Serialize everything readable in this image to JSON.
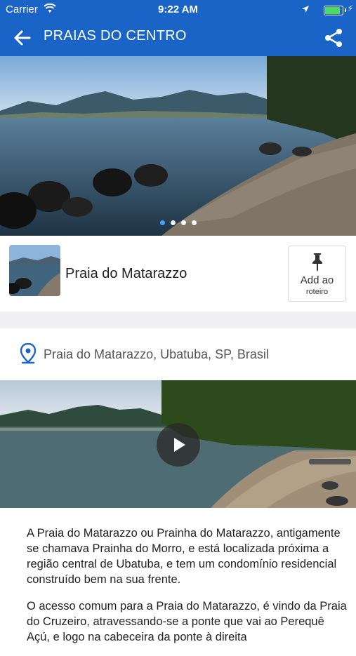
{
  "status_bar": {
    "carrier": "Carrier",
    "time": "9:22 AM",
    "battery_level": 0.95,
    "icons": [
      "wifi-icon",
      "location-arrow-icon",
      "battery-icon",
      "charging-bolt-icon"
    ]
  },
  "nav": {
    "title": "PRAIAS DO CENTRO",
    "back_icon": "back-arrow-icon",
    "share_icon": "share-icon",
    "bar_color": "#1a64c8"
  },
  "gallery": {
    "image": "beach-panorama-photo",
    "page_count": 4,
    "current_page": 1
  },
  "place": {
    "name": "Praia do Matarazzo",
    "thumbnail": "beach-thumbnail-photo",
    "add_button": {
      "line1": "Add ao",
      "line2": "roteiro",
      "icon": "pushpin-icon"
    }
  },
  "address": {
    "text": "Praia do Matarazzo, Ubatuba, SP, Brasil",
    "icon": "map-pin-icon",
    "icon_color": "#1a64c8"
  },
  "video": {
    "thumbnail": "beach-video-thumbnail",
    "play_icon": "play-icon"
  },
  "description": {
    "p1": "A Praia do Matarazzo ou Prainha do Matarazzo, antigamente se chamava Prainha do Morro, e está localizada próxima a região central de Ubatuba, e tem um condomínio residencial construído bem na sua frente.",
    "p2": "O acesso comum para a Praia do Matarazzo, é vindo da Praia do Cruzeiro, atravessando-se a ponte que vai ao Perequê Açú, e logo na cabeceira da ponte à direita"
  }
}
